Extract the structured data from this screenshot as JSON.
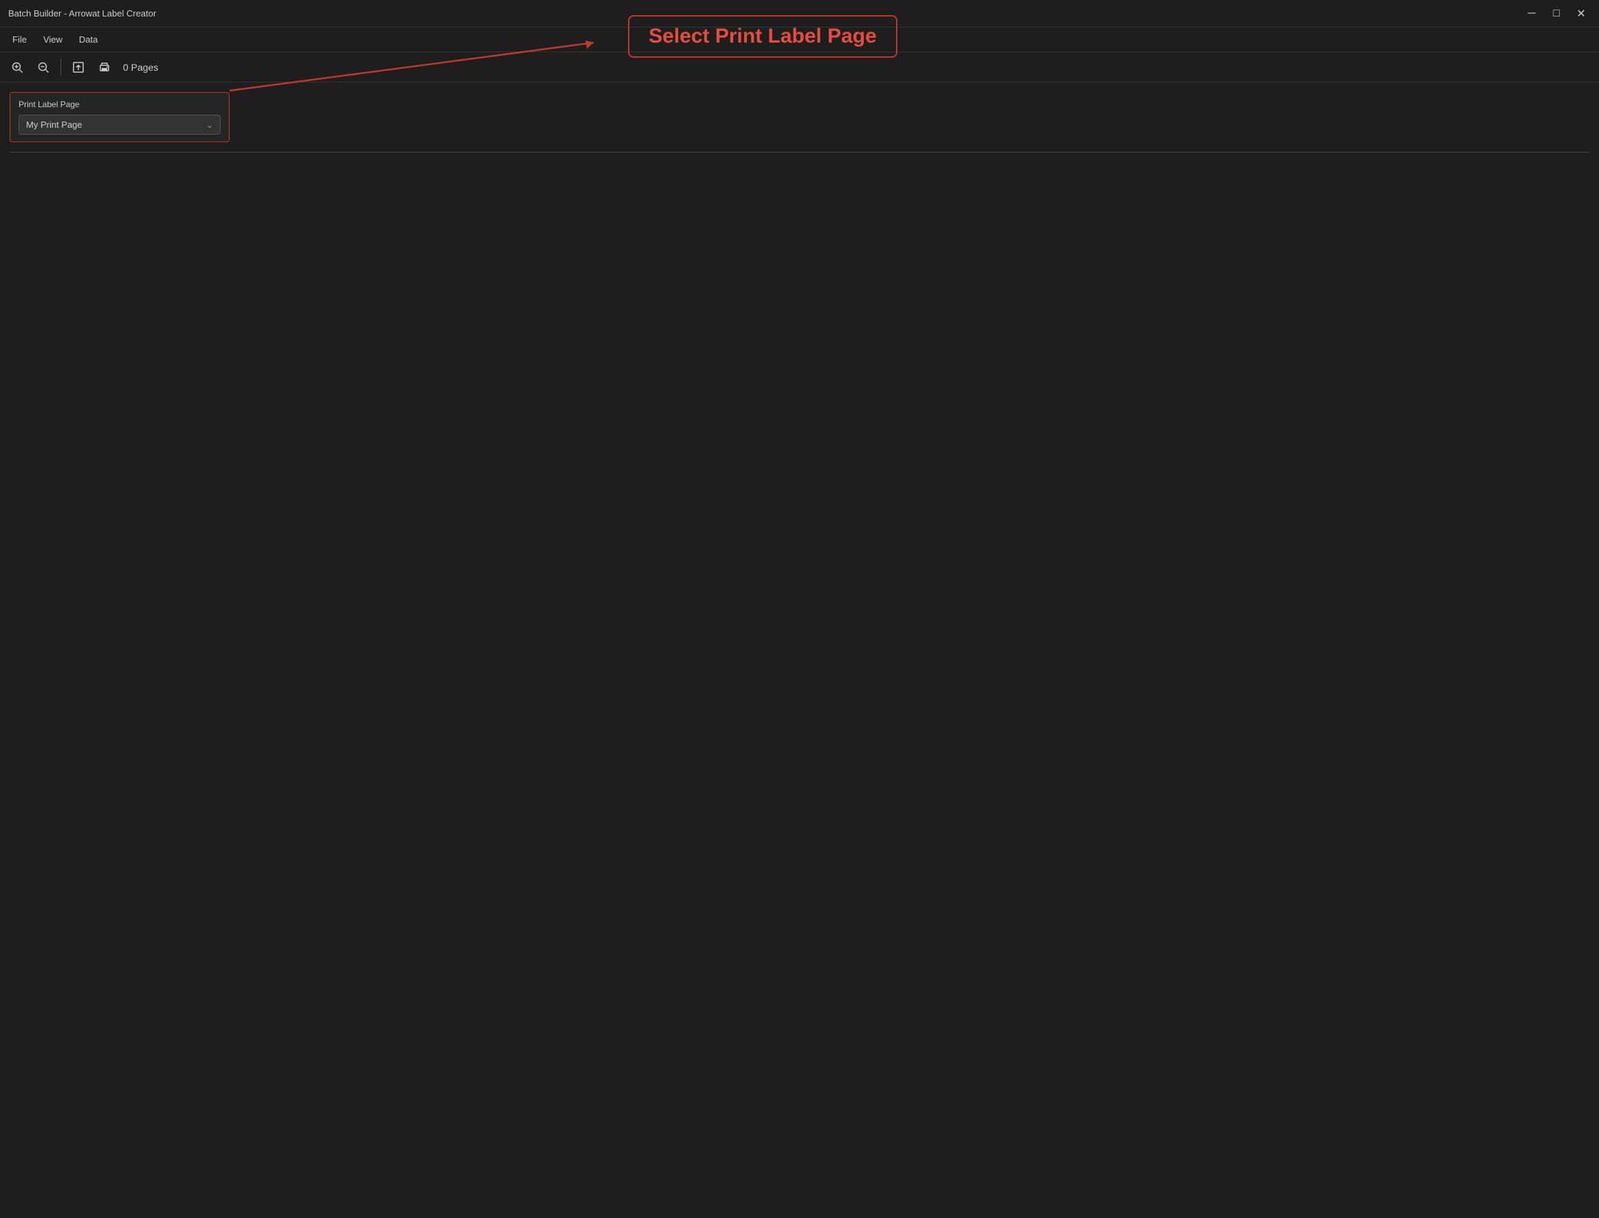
{
  "titleBar": {
    "title": "Batch Builder - Arrowat Label Creator",
    "minimize": "─",
    "maximize": "□",
    "close": "✕"
  },
  "menuBar": {
    "items": [
      {
        "label": "File"
      },
      {
        "label": "View"
      },
      {
        "label": "Data"
      }
    ]
  },
  "toolbar": {
    "zoomIn": "+",
    "zoomOut": "−",
    "export": "↑",
    "print": "🖶",
    "pages": "0 Pages"
  },
  "printLabelPanel": {
    "title": "Print Label Page",
    "dropdownValue": "My Print Page"
  },
  "annotation": {
    "label": "Select Print Label Page"
  }
}
